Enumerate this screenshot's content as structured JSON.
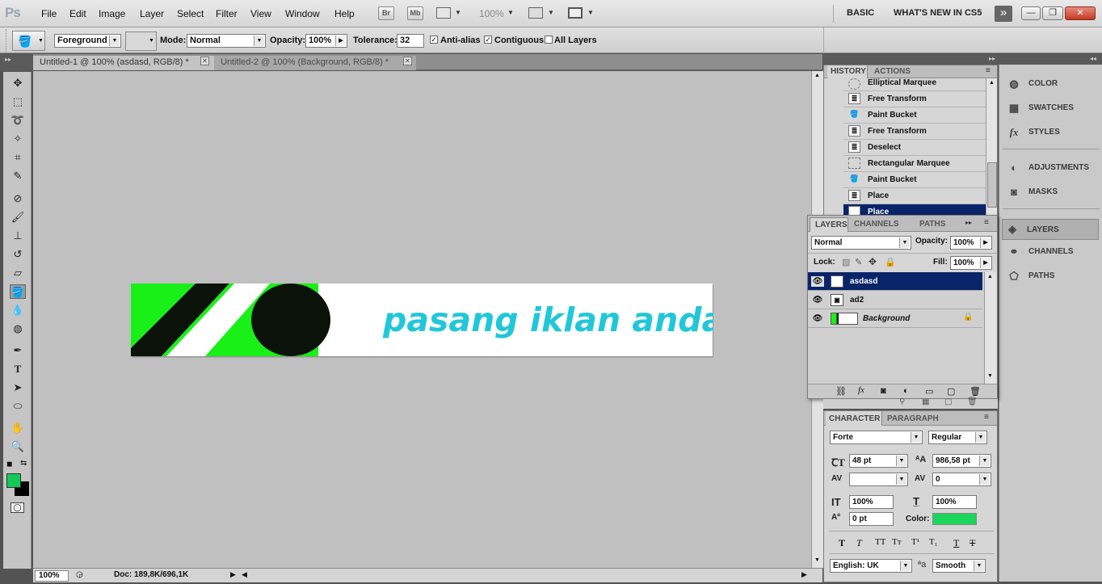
{
  "app": {
    "logo": "Ps"
  },
  "menu": [
    "File",
    "Edit",
    "Image",
    "Layer",
    "Select",
    "Filter",
    "View",
    "Window",
    "Help"
  ],
  "appbar": {
    "bridge": "Br",
    "minibridge": "Mb",
    "zoom": "100%"
  },
  "workspaces": {
    "basic": "BASIC",
    "whats_new": "WHAT'S NEW IN CS5",
    "more": "»"
  },
  "window_controls": {
    "minimize": "—",
    "restore": "❐",
    "close": "✕"
  },
  "options": {
    "fill_source": "Foreground",
    "mode_label": "Mode:",
    "mode_value": "Normal",
    "opacity_label": "Opacity:",
    "opacity_value": "100%",
    "tolerance_label": "Tolerance:",
    "tolerance_value": "32",
    "antialias_label": "Anti-alias",
    "contiguous_label": "Contiguous",
    "alllayers_label": "All Layers",
    "check": "✓"
  },
  "tabs": [
    {
      "label": "Untitled-1 @ 100% (asdasd, RGB/8) *"
    },
    {
      "label": "Untitled-2 @ 100% (Background, RGB/8) *"
    }
  ],
  "banner": {
    "text": "pasang iklan anda",
    "text_color": "#21c7d9",
    "green": "#18f018",
    "dark": "#0a1209"
  },
  "status": {
    "zoom": "100%",
    "doc": "Doc: 189,8K/696,1K"
  },
  "history": {
    "tab_history": "HISTORY",
    "tab_actions": "ACTIONS",
    "items": [
      {
        "label": "Elliptical Marquee",
        "icon": "ellipse-marquee-icon"
      },
      {
        "label": "Free Transform",
        "icon": "document-icon"
      },
      {
        "label": "Paint Bucket",
        "icon": "paint-bucket-icon"
      },
      {
        "label": "Free Transform",
        "icon": "document-icon"
      },
      {
        "label": "Deselect",
        "icon": "document-icon"
      },
      {
        "label": "Rectangular Marquee",
        "icon": "rect-marquee-icon"
      },
      {
        "label": "Paint Bucket",
        "icon": "paint-bucket-icon"
      },
      {
        "label": "Place",
        "icon": "document-icon"
      },
      {
        "label": "Place",
        "icon": "document-icon"
      }
    ]
  },
  "side_panels": {
    "color": "COLOR",
    "swatches": "SWATCHES",
    "styles": "STYLES",
    "adjustments": "ADJUSTMENTS",
    "masks": "MASKS",
    "layers": "LAYERS",
    "channels": "CHANNELS",
    "paths": "PATHS"
  },
  "layers": {
    "tab_layers": "LAYERS",
    "tab_channels": "CHANNELS",
    "tab_paths": "PATHS",
    "blend": "Normal",
    "opacity_label": "Opacity:",
    "opacity_value": "100%",
    "lock_label": "Lock:",
    "fill_label": "Fill:",
    "fill_value": "100%",
    "items": [
      {
        "name": "asdasd"
      },
      {
        "name": "ad2"
      },
      {
        "name": "Background"
      }
    ]
  },
  "character": {
    "tab_character": "CHARACTER",
    "tab_paragraph": "PARAGRAPH",
    "font": "Forte",
    "style": "Regular",
    "size": "48 pt",
    "leading": "986,58 pt",
    "kerning": "",
    "tracking": "0",
    "vscale": "100%",
    "hscale": "100%",
    "baseline": "0 pt",
    "color_label": "Color:",
    "color": "#1bd65a",
    "language": "English: UK",
    "aa": "Smooth"
  },
  "colors": {
    "foreground": "#14c85a",
    "background": "#000000"
  }
}
